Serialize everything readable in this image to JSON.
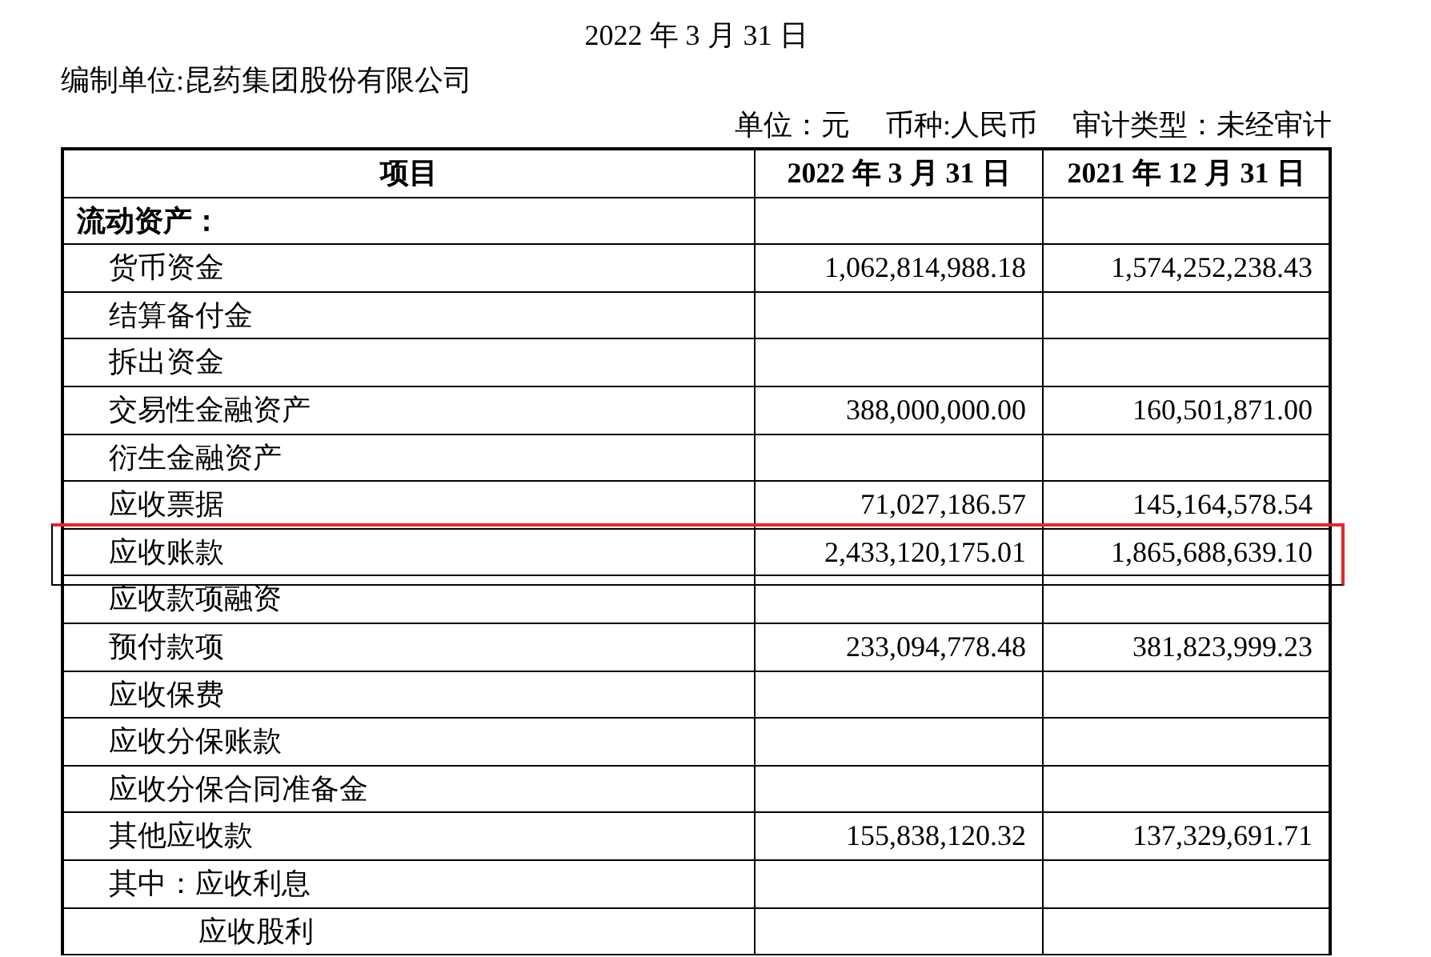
{
  "title": "2022 年 3 月 31 日",
  "company": "编制单位:昆药集团股份有限公司",
  "meta": [
    "单位：元",
    "币种:人民币",
    "审计类型：未经审计"
  ],
  "table": {
    "columns": [
      "项目",
      "2022 年 3 月 31 日",
      "2021 年 12 月 31 日"
    ],
    "sections": [
      {
        "title": "流动资产：",
        "rows": [
          {
            "item": "货币资金",
            "values": [
              "1,062,814,988.18",
              "1,574,252,238.43"
            ],
            "highlighted": false
          },
          {
            "item": "结算备付金",
            "values": [],
            "highlighted": false
          },
          {
            "item": "拆出资金",
            "values": [],
            "highlighted": false
          },
          {
            "item": "交易性金融资产",
            "values": [
              "388,000,000.00",
              "160,501,871.00"
            ],
            "highlighted": false
          },
          {
            "item": "衍生金融资产",
            "values": [],
            "highlighted": false
          },
          {
            "item": "应收票据",
            "values": [
              "71,027,186.57",
              "145,164,578.54"
            ],
            "highlighted": false
          },
          {
            "item": "应收账款",
            "values": [
              "2,433,120,175.01",
              "1,865,688,639.10"
            ],
            "highlighted": true
          },
          {
            "item": "应收款项融资",
            "values": [],
            "highlighted": false
          },
          {
            "item": "预付款项",
            "values": [
              "233,094,778.48",
              "381,823,999.23"
            ],
            "highlighted": false
          },
          {
            "item": "应收保费",
            "values": [],
            "highlighted": false
          },
          {
            "item": "应收分保账款",
            "values": [],
            "highlighted": false
          },
          {
            "item": "应收分保合同准备金",
            "values": [],
            "highlighted": false
          },
          {
            "item": "其他应收款",
            "values": [
              "155,838,120.32",
              "137,329,691.71"
            ],
            "highlighted": false
          },
          {
            "item": "其中：应收利息",
            "values": [],
            "highlighted": false,
            "children": [
              {
                "item": "应收股利",
                "highlighted": false
              }
            ]
          }
        ]
      }
    ]
  }
}
